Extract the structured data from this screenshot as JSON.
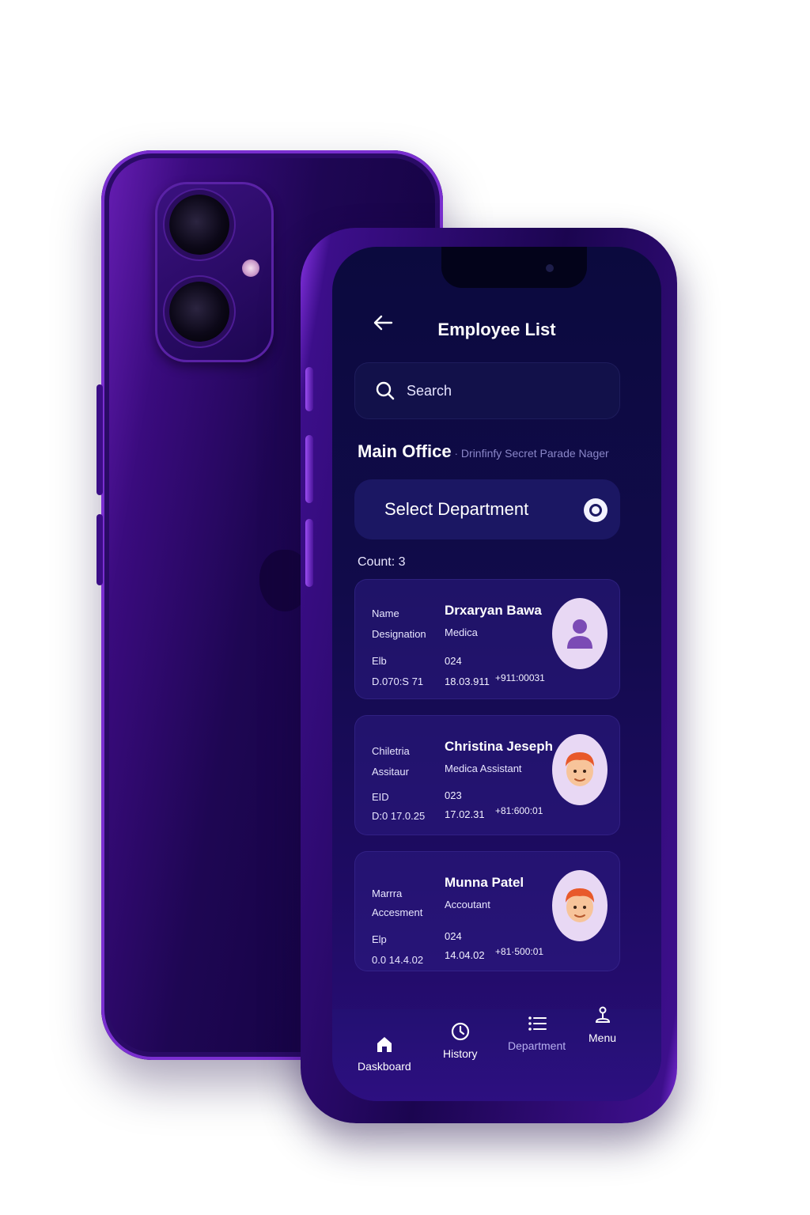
{
  "header": {
    "title": "Employee List",
    "back_icon": "arrow-left-icon"
  },
  "search": {
    "placeholder": "Search",
    "icon": "search-icon"
  },
  "office": {
    "name": "Main Office",
    "separator": "·",
    "address": "Drinfinfy Secret Parade Nager"
  },
  "department_select": {
    "label": "Select Department",
    "icon": "toggle-icon"
  },
  "count": {
    "label": "Count: 3"
  },
  "employees": [
    {
      "label_1": "Name",
      "label_2": "Designation",
      "label_3": "Elb",
      "label_4": "D.070:S 71",
      "name": "Drxaryan Bawa",
      "designation": "Medica",
      "code": "024",
      "date": "18.03.911",
      "phone": "+911:00031",
      "avatar": "person-silhouette-icon"
    },
    {
      "label_1": "Chiletria",
      "label_2": "Assitaur",
      "label_3": "EID",
      "label_4": "D:0 17.0.25",
      "name": "Christina Jeseph",
      "designation": "Medica  Assistant",
      "code": "023",
      "date": "17.02.31",
      "phone": "+81:600:01",
      "avatar": "face-avatar-icon"
    },
    {
      "label_1": "Marrra",
      "label_2": "Accesment",
      "label_3": "Elp",
      "label_4": "0.0 14.4.02",
      "name": "Munna Patel",
      "designation": "Accoutant",
      "code": "024",
      "date": "14.04.02",
      "phone": "+81·500:01",
      "avatar": "face-avatar-icon"
    }
  ],
  "tabbar": {
    "items": [
      {
        "label": "Daskboard",
        "icon": "home-icon",
        "active": true
      },
      {
        "label": "History",
        "icon": "clock-icon",
        "active": true
      },
      {
        "label": "Department",
        "icon": "list-icon",
        "active": false
      },
      {
        "label": "Menu",
        "icon": "joystick-icon",
        "active": true
      }
    ]
  },
  "colors": {
    "phone_body": "#1e0653",
    "phone_edge": "#8a34e8",
    "screen_bg": "#0b0a3e",
    "card_bg": "#2c1c82",
    "accent": "#1b1763"
  }
}
